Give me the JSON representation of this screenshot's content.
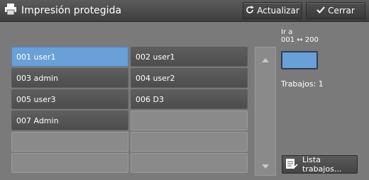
{
  "title": "Impresión protegida",
  "toolbar": {
    "refresh_label": "Actualizar",
    "close_label": "Cerrar"
  },
  "users": [
    {
      "label": "001 user1",
      "selected": true
    },
    {
      "label": "002 user1"
    },
    {
      "label": "003 admin"
    },
    {
      "label": "004 user2"
    },
    {
      "label": "005 user3"
    },
    {
      "label": "006 D3"
    },
    {
      "label": "007 Admin"
    }
  ],
  "goto": {
    "label": "Ir a",
    "range": "001 ↔ 200"
  },
  "jobs_count": "Trabajos: 1",
  "jobs_button": "Lista trabajos...",
  "icons": [
    "printer-icon",
    "refresh-icon",
    "check-icon",
    "arrow-up-icon",
    "arrow-down-icon",
    "job-list-icon"
  ],
  "colors": {
    "selected": "#6aa0d8",
    "toolbar": "#4a4a4a"
  }
}
